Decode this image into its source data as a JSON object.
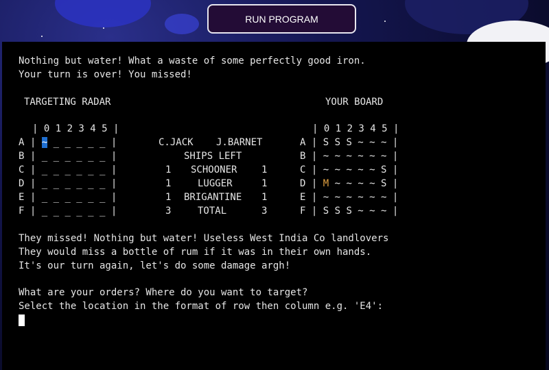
{
  "colors": {
    "terminal_bg": "#000000",
    "terminal_text": "#e6e6e6",
    "button_bg": "#230c36",
    "button_border": "#e8e6ef",
    "cursor_highlight": "#1f6fd1",
    "miss_marker": "#e0a040"
  },
  "run_button": {
    "label": "RUN PROGRAM"
  },
  "terminal": {
    "messages_top": [
      "Nothing but water! What a waste of some perfectly good iron.",
      "Your turn is over! You missed!"
    ],
    "radar_title": "TARGETING RADAR",
    "board_title": "YOUR BOARD",
    "radar_header": "| 0 1 2 3 4 5 |",
    "radar_rows": [
      {
        "row": "A",
        "pre": " | ",
        "sel": "~",
        "post": " _ _ _ _ _ |"
      },
      {
        "row": "B",
        "text": " | _ _ _ _ _ _ |"
      },
      {
        "row": "C",
        "text": " | _ _ _ _ _ _ |"
      },
      {
        "row": "D",
        "text": " | _ _ _ _ _ _ |"
      },
      {
        "row": "E",
        "text": " | _ _ _ _ _ _ |"
      },
      {
        "row": "F",
        "text": " | _ _ _ _ _ _ |"
      }
    ],
    "scoreboard": {
      "player1": "C.JACK",
      "player2": "J.BARNET",
      "heading": "SHIPS LEFT",
      "rows": [
        {
          "left": "1",
          "ship": "SCHOONER",
          "right": "1"
        },
        {
          "left": "1",
          "ship": "LUGGER",
          "right": "1"
        },
        {
          "left": "1",
          "ship": "BRIGANTINE",
          "right": "1"
        },
        {
          "left": "3",
          "ship": "TOTAL",
          "right": "3"
        }
      ]
    },
    "board_header": "| 0 1 2 3 4 5 |",
    "board_rows": [
      {
        "row": "A",
        "text": " | S S S ~ ~ ~ |"
      },
      {
        "row": "B",
        "text": " | ~ ~ ~ ~ ~ ~ |"
      },
      {
        "row": "C",
        "text": " | ~ ~ ~ ~ ~ S |"
      },
      {
        "row": "D",
        "pre": " | ",
        "miss": "M",
        "post": " ~ ~ ~ ~ S |"
      },
      {
        "row": "E",
        "text": " | ~ ~ ~ ~ ~ ~ |"
      },
      {
        "row": "F",
        "text": " | S S S ~ ~ ~ |"
      }
    ],
    "messages_bottom": [
      "They missed! Nothing but water! Useless West India Co landlovers",
      "They would miss a bottle of rum if it was in their own hands.",
      "It's our turn again, let's do some damage argh!"
    ],
    "prompt": [
      "What are your orders? Where do you want to target?",
      "Select the location in the format of row then column e.g. 'E4':"
    ]
  }
}
